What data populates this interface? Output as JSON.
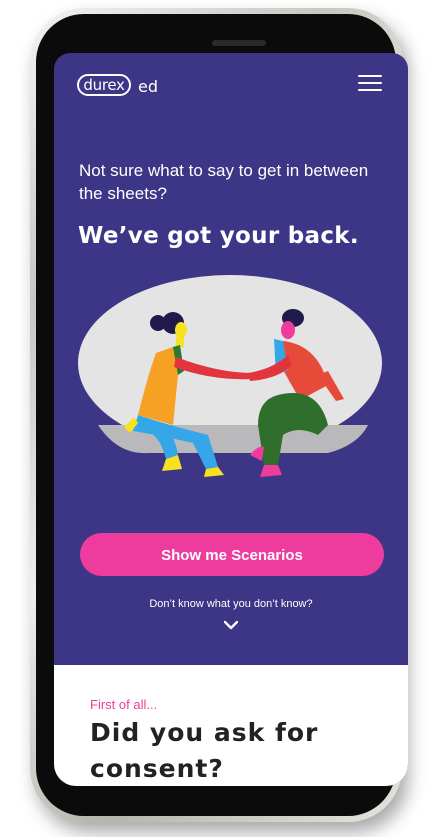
{
  "brand": {
    "logo_text": "durex",
    "suffix": "ed"
  },
  "hero": {
    "intro": "Not sure what to say to get in between the sheets?",
    "headline": "We’ve got your back."
  },
  "cta": {
    "label": "Show me Scenarios"
  },
  "scroll_hint": {
    "text": "Don’t know what you don’t know?"
  },
  "section": {
    "eyebrow": "First of all...",
    "title": "Did you ask for consent?"
  },
  "colors": {
    "background": "#3d3585",
    "accent": "#ee3c9e",
    "text_on_dark": "#ffffff",
    "section_bg": "#ffffff"
  },
  "icons": [
    "menu-icon",
    "chevron-down-icon"
  ]
}
